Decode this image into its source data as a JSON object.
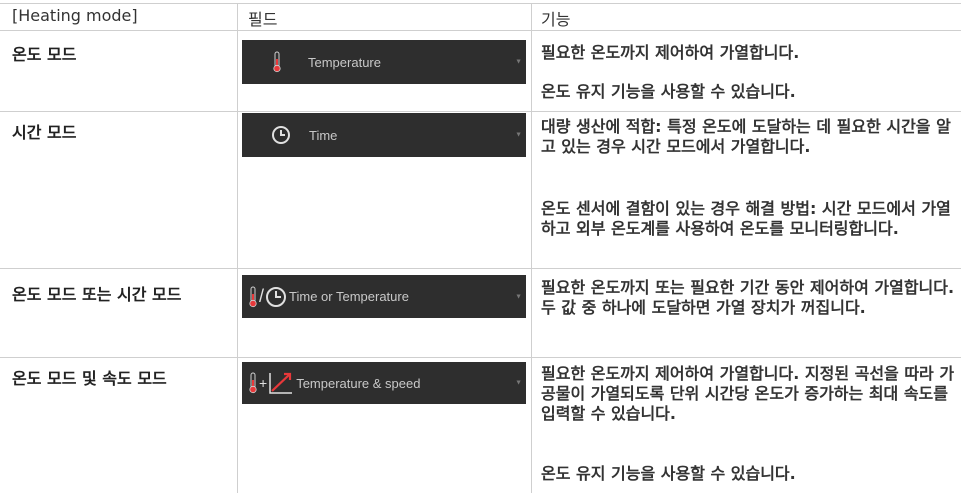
{
  "header": {
    "col_mode": "[Heating mode]",
    "col_field": "필드",
    "col_function": "기능"
  },
  "rows": [
    {
      "mode": "온도 모드",
      "field_label": "Temperature",
      "field_icon": "thermometer-icon",
      "functions": [
        "필요한 온도까지 제어하여 가열합니다.",
        "온도 유지 기능을 사용할 수 있습니다."
      ]
    },
    {
      "mode": "시간 모드",
      "field_label": "Time",
      "field_icon": "clock-icon",
      "functions": [
        "대량 생산에 적합: 특정 온도에 도달하는 데 필요한 시간을 알고 있는 경우 시간 모드에서 가열합니다.",
        "온도 센서에 결함이 있는 경우 해결 방법: 시간 모드에서 가열하고 외부 온도계를 사용하여 온도를 모니터링합니다."
      ]
    },
    {
      "mode": "온도 모드 또는 시간 모드",
      "field_label": "Time or Temperature",
      "field_icon": "thermometer-or-clock-icon",
      "field_separator": "/",
      "functions": [
        "필요한 온도까지 또는 필요한 기간 동안 제어하여 가열합니다. 두 값 중 하나에 도달하면 가열 장치가 꺼집니다."
      ]
    },
    {
      "mode": "온도 모드 및 속도 모드",
      "field_label": "Temperature & speed",
      "field_icon": "thermometer-plus-ramp-icon",
      "field_separator": "+",
      "functions": [
        "필요한 온도까지 제어하여 가열합니다. 지정된 곡선을 따라 가공물이 가열되도록 단위 시간당 온도가 증가하는 최대 속도를 입력할 수 있습니다.",
        "온도 유지 기능을 사용할 수 있습니다."
      ]
    }
  ],
  "colors": {
    "field_bg": "#2e2e2e",
    "thermometer_red": "#e8383a",
    "ramp_red": "#e8383a",
    "grid": "#cfcfcf"
  }
}
